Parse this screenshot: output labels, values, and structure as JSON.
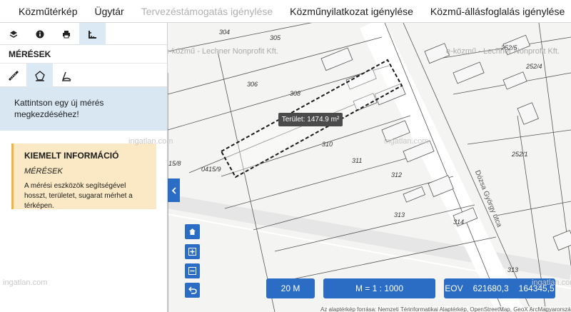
{
  "nav": {
    "items": [
      {
        "label": "Közműtérkép",
        "disabled": false
      },
      {
        "label": "Ügytár",
        "disabled": false
      },
      {
        "label": "Tervezéstámogatás igénylése",
        "disabled": true
      },
      {
        "label": "Közműnyilatkozat igénylése",
        "disabled": false
      },
      {
        "label": "Közmű-állásfoglalás igénylése",
        "disabled": false
      }
    ]
  },
  "panel": {
    "section_title": "MÉRÉSEK",
    "hint": "Kattintson egy új mérés megkezdéséhez!",
    "info": {
      "title": "KIEMELT INFORMÁCIÓ",
      "subtitle": "MÉRÉSEK",
      "text": "A mérési eszközök segítségével hosszt, területet, sugarat mérhet a térképen."
    }
  },
  "map": {
    "area_label": "Terület: 1474.9 m²",
    "parcels": [
      "304",
      "305",
      "306",
      "308",
      "310",
      "311",
      "312",
      "313",
      "314",
      "313",
      "252/5",
      "252/4",
      "252/1",
      "0415/9",
      "15/8"
    ],
    "street_name": "Dózsa György utca",
    "watermark_lechner": "e-közmű - Lechner Nonprofit Kft.",
    "watermark_ingatlan": "ingatlan.com",
    "scale_bar": "20 M",
    "scale_ratio": "M = 1 : 1000",
    "coords": {
      "system": "EOV",
      "x": "621680,3",
      "y": "164345,5"
    },
    "attribution": "Az alaptérkép forrása: Nemzeti Térinformatikai Alaptérkép, OpenStreetMap, GeoX ArcMagyarország"
  },
  "colors": {
    "accent": "#2b6cc4",
    "hint_bg": "#d9e7f3",
    "info_bg": "#fbe8c4",
    "info_border": "#f0b43c"
  }
}
